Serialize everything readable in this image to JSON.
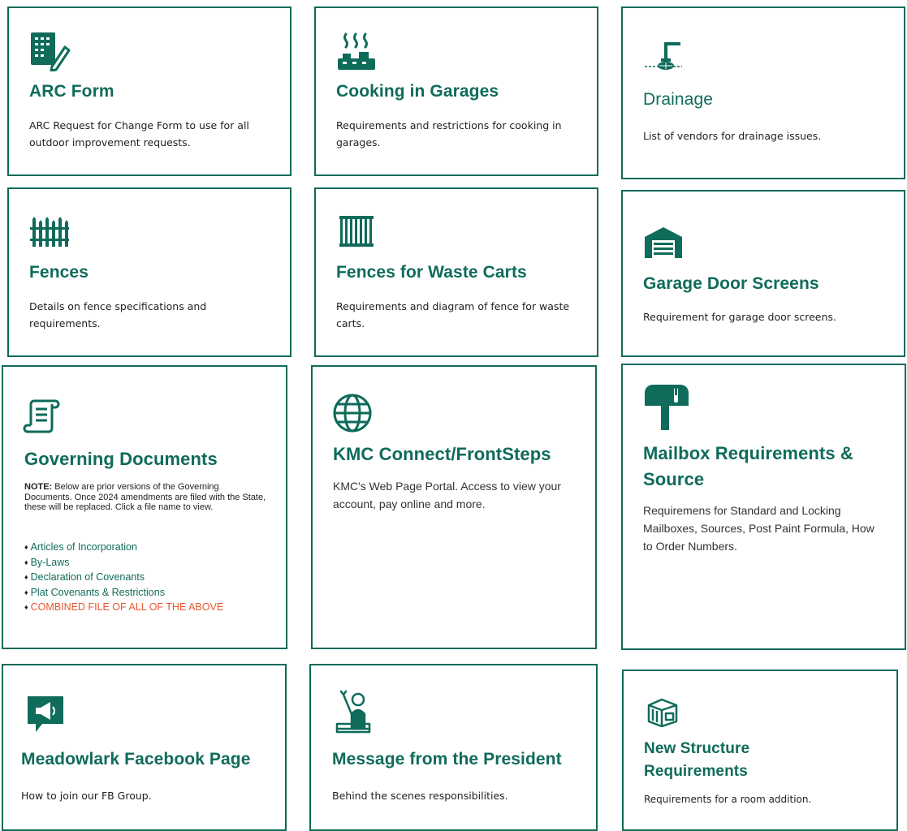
{
  "colors": {
    "accent": "#0f6b5a",
    "highlight_link": "#e8572f"
  },
  "cards": {
    "arc_form": {
      "icon": "form-pen-icon",
      "title": "ARC Form",
      "description": "ARC Request for Change Form to use for all outdoor improvement requests."
    },
    "cooking_in_garages": {
      "icon": "grill-icon",
      "title": "Cooking in Garages",
      "description": "Requirements and restrictions for cooking in garages."
    },
    "drainage": {
      "icon": "drain-pipe-icon",
      "title": "Drainage",
      "description": "List of vendors for drainage issues."
    },
    "fences": {
      "icon": "fence-icon",
      "title": "Fences",
      "description": "Details on fence specifications and requirements."
    },
    "fences_for_waste_carts": {
      "icon": "fence-panel-icon",
      "title": "Fences for Waste Carts",
      "description": "Requirements and diagram of fence for waste carts."
    },
    "garage_door_screens": {
      "icon": "garage-icon",
      "title": "Garage Door Screens",
      "description": "Requirement for garage door screens."
    },
    "governing_documents": {
      "icon": "scroll-icon",
      "title": "Governing Documents",
      "note_label": "NOTE:",
      "note_text": " Below are prior versions of the Governing Documents.  Once 2024 amendments are filed with the State, these will be replaced. Click a file name to view.",
      "bullet": "♦",
      "links": [
        "Articles of Incorporation",
        "By-Laws",
        "Declaration of Covenants",
        "Plat Covenants & Restrictions",
        "COMBINED FILE OF ALL OF THE ABOVE"
      ]
    },
    "kmc_connect": {
      "icon": "globe-icon",
      "title": "KMC Connect/FrontSteps",
      "description": "KMC's Web Page Portal. Access to view your account, pay online and more."
    },
    "mailbox": {
      "icon": "mailbox-icon",
      "title_line1": "Mailbox Requirements &",
      "title_line2": "Source",
      "description": "Requiremens for Standard and Locking Mailboxes, Sources, Post Paint Formula, How to Order Numbers."
    },
    "facebook": {
      "icon": "megaphone-icon",
      "title": "Meadowlark Facebook Page",
      "description": "How to join our FB Group."
    },
    "president": {
      "icon": "person-waving-icon",
      "title": "Message from the President",
      "description": "Behind the scenes responsibilities."
    },
    "new_structure": {
      "icon": "building-box-icon",
      "title_line1": "New Structure",
      "title_line2": "Requirements",
      "description": "Requirements for a room addition."
    }
  }
}
